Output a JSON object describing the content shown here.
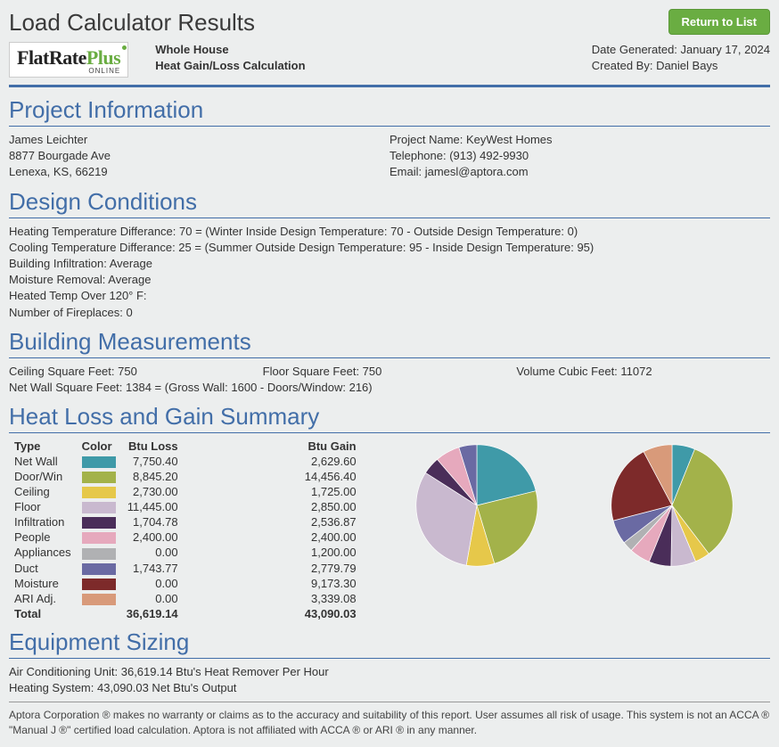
{
  "header": {
    "title": "Load Calculator Results",
    "return_btn": "Return to List",
    "logo_main": "FlatRate",
    "logo_plus": "Plus",
    "logo_sub": "ONLINE",
    "sub_line1": "Whole House",
    "sub_line2": "Heat Gain/Loss Calculation",
    "date_label": "Date Generated: ",
    "date_value": "January 17, 2024",
    "created_label": "Created By: ",
    "created_value": "Daniel Bays"
  },
  "project": {
    "heading": "Project Information",
    "name": "James Leichter",
    "addr1": "8877 Bourgade Ave",
    "addr2": "Lenexa, KS, 66219",
    "proj_name": "Project Name: KeyWest Homes",
    "tel": "Telephone: (913) 492-9930",
    "email": "Email: jamesl@aptora.com"
  },
  "design": {
    "heading": "Design Conditions",
    "l1": "Heating Temperature Differance: 70 = (Winter Inside Design Temperature: 70 - Outside Design Temperature: 0)",
    "l2": "Cooling Temperature Differance: 25 = (Summer Outside Design Temperature: 95 - Inside Design Temperature: 95)",
    "l3": "Building Infiltration: Average",
    "l4": "Moisture Removal: Average",
    "l5": "Heated Temp Over 120° F:",
    "l6": "Number of Fireplaces: 0"
  },
  "meas": {
    "heading": "Building Measurements",
    "c1": "Ceiling Square Feet: 750",
    "c2": "Floor Square Feet: 750",
    "c3": "Volume Cubic Feet: 11072",
    "net": "Net Wall Square Feet: 1384 = (Gross Wall: 1600 - Doors/Window: 216)"
  },
  "heat": {
    "heading": "Heat Loss and Gain Summary",
    "col_type": "Type",
    "col_color": "Color",
    "col_loss": "Btu Loss",
    "col_gain": "Btu Gain",
    "total_label": "Total",
    "total_loss": "36,619.14",
    "total_gain": "43,090.03",
    "rows": [
      {
        "type": "Net Wall",
        "color": "#3f9aa8",
        "loss": "7,750.40",
        "gain": "2,629.60"
      },
      {
        "type": "Door/Win",
        "color": "#a3b24a",
        "loss": "8,845.20",
        "gain": "14,456.40"
      },
      {
        "type": "Ceiling",
        "color": "#e6c84a",
        "loss": "2,730.00",
        "gain": "1,725.00"
      },
      {
        "type": "Floor",
        "color": "#c9b9cf",
        "loss": "11,445.00",
        "gain": "2,850.00"
      },
      {
        "type": "Infiltration",
        "color": "#4a2d59",
        "loss": "1,704.78",
        "gain": "2,536.87"
      },
      {
        "type": "People",
        "color": "#e6a9bd",
        "loss": "2,400.00",
        "gain": "2,400.00"
      },
      {
        "type": "Appliances",
        "color": "#b0b1b3",
        "loss": "0.00",
        "gain": "1,200.00"
      },
      {
        "type": "Duct",
        "color": "#6a6aa3",
        "loss": "1,743.77",
        "gain": "2,779.79"
      },
      {
        "type": "Moisture",
        "color": "#7d2a2a",
        "loss": "0.00",
        "gain": "9,173.30"
      },
      {
        "type": "ARI Adj.",
        "color": "#d89a7a",
        "loss": "0.00",
        "gain": "3,339.08"
      }
    ]
  },
  "equip": {
    "heading": "Equipment Sizing",
    "l1": "Air Conditioning Unit: 36,619.14 Btu's Heat Remover Per Hour",
    "l2": "Heating System: 43,090.03 Net Btu's Output"
  },
  "footer": "Aptora Corporation ® makes no warranty or claims as to the accuracy and suitability of this report. User assumes all risk of usage. This system is not an ACCA ® \"Manual J ®\" certified load calculation. Aptora is not affiliated with ACCA ® or ARI ® in any manner.",
  "chart_data": [
    {
      "type": "pie",
      "title": "Btu Loss",
      "series": [
        {
          "name": "Net Wall",
          "value": 7750.4,
          "color": "#3f9aa8"
        },
        {
          "name": "Door/Win",
          "value": 8845.2,
          "color": "#a3b24a"
        },
        {
          "name": "Ceiling",
          "value": 2730.0,
          "color": "#e6c84a"
        },
        {
          "name": "Floor",
          "value": 11445.0,
          "color": "#c9b9cf"
        },
        {
          "name": "Infiltration",
          "value": 1704.78,
          "color": "#4a2d59"
        },
        {
          "name": "People",
          "value": 2400.0,
          "color": "#e6a9bd"
        },
        {
          "name": "Appliances",
          "value": 0.0,
          "color": "#b0b1b3"
        },
        {
          "name": "Duct",
          "value": 1743.77,
          "color": "#6a6aa3"
        },
        {
          "name": "Moisture",
          "value": 0.0,
          "color": "#7d2a2a"
        },
        {
          "name": "ARI Adj.",
          "value": 0.0,
          "color": "#d89a7a"
        }
      ]
    },
    {
      "type": "pie",
      "title": "Btu Gain",
      "series": [
        {
          "name": "Net Wall",
          "value": 2629.6,
          "color": "#3f9aa8"
        },
        {
          "name": "Door/Win",
          "value": 14456.4,
          "color": "#a3b24a"
        },
        {
          "name": "Ceiling",
          "value": 1725.0,
          "color": "#e6c84a"
        },
        {
          "name": "Floor",
          "value": 2850.0,
          "color": "#c9b9cf"
        },
        {
          "name": "Infiltration",
          "value": 2536.87,
          "color": "#4a2d59"
        },
        {
          "name": "People",
          "value": 2400.0,
          "color": "#e6a9bd"
        },
        {
          "name": "Appliances",
          "value": 1200.0,
          "color": "#b0b1b3"
        },
        {
          "name": "Duct",
          "value": 2779.79,
          "color": "#6a6aa3"
        },
        {
          "name": "Moisture",
          "value": 9173.3,
          "color": "#7d2a2a"
        },
        {
          "name": "ARI Adj.",
          "value": 3339.08,
          "color": "#d89a7a"
        }
      ]
    }
  ]
}
